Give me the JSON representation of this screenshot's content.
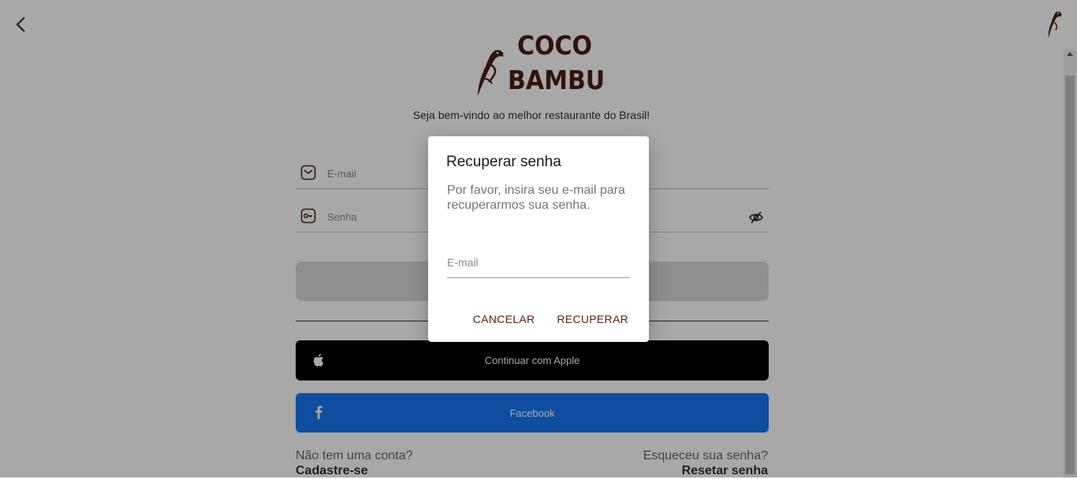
{
  "brand": {
    "logo_line1": "COCO",
    "logo_line2": "BAMBU",
    "color": "#4a1f10"
  },
  "topbar": {
    "back_icon": "chevron-left-icon",
    "corner_icon": "bird-logo-icon"
  },
  "welcome_text": "Seja bem-vindo ao melhor restaurante do Brasil!",
  "login_form": {
    "email_placeholder": "E-mail",
    "password_placeholder": "Senha"
  },
  "social": {
    "apple_label": "Continuar com Apple",
    "facebook_label": "Facebook",
    "facebook_color": "#1877f2"
  },
  "footer": {
    "signup_question": "Não tem uma conta?",
    "signup_link": "Cadastre-se",
    "forgot_question": "Esqueceu sua senha?",
    "forgot_link": "Resetar senha"
  },
  "dialog": {
    "title": "Recuperar senha",
    "message": "Por favor, insira seu e-mail para recuperarmos sua senha.",
    "email_placeholder": "E-mail",
    "cancel_label": "CANCELAR",
    "confirm_label": "RECUPERAR",
    "accent_color": "#5a1f0c"
  }
}
